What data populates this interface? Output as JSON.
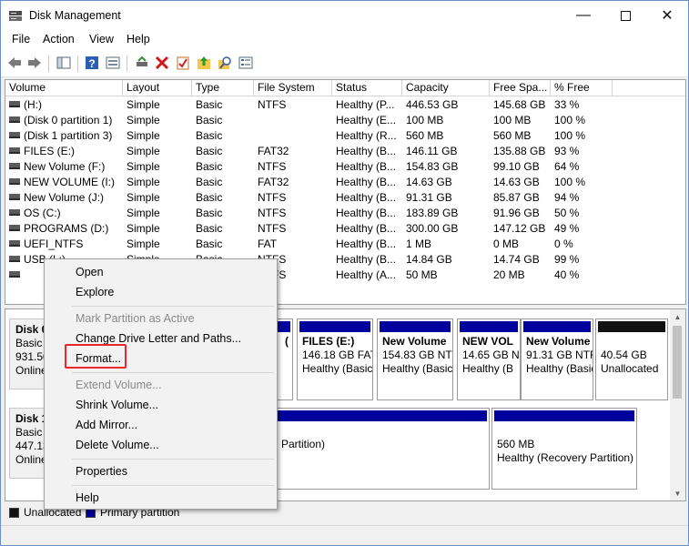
{
  "window": {
    "title": "Disk Management"
  },
  "menubar": {
    "items": [
      "File",
      "Action",
      "View",
      "Help"
    ]
  },
  "table": {
    "columns": [
      "Volume",
      "Layout",
      "Type",
      "File System",
      "Status",
      "Capacity",
      "Free Spa...",
      "% Free"
    ],
    "rows": [
      [
        "(H:)",
        "Simple",
        "Basic",
        "NTFS",
        "Healthy (P...",
        "446.53 GB",
        "145.68 GB",
        "33 %"
      ],
      [
        "(Disk 0 partition 1)",
        "Simple",
        "Basic",
        "",
        "Healthy (E...",
        "100 MB",
        "100 MB",
        "100 %"
      ],
      [
        "(Disk 1 partition 3)",
        "Simple",
        "Basic",
        "",
        "Healthy (R...",
        "560 MB",
        "560 MB",
        "100 %"
      ],
      [
        "FILES (E:)",
        "Simple",
        "Basic",
        "FAT32",
        "Healthy (B...",
        "146.11 GB",
        "135.88 GB",
        "93 %"
      ],
      [
        "New Volume (F:)",
        "Simple",
        "Basic",
        "NTFS",
        "Healthy (B...",
        "154.83 GB",
        "99.10 GB",
        "64 %"
      ],
      [
        "NEW VOLUME (I:)",
        "Simple",
        "Basic",
        "FAT32",
        "Healthy (B...",
        "14.63 GB",
        "14.63 GB",
        "100 %"
      ],
      [
        "New Volume (J:)",
        "Simple",
        "Basic",
        "NTFS",
        "Healthy (B...",
        "91.31 GB",
        "85.87 GB",
        "94 %"
      ],
      [
        "OS (C:)",
        "Simple",
        "Basic",
        "NTFS",
        "Healthy (B...",
        "183.89 GB",
        "91.96 GB",
        "50 %"
      ],
      [
        "PROGRAMS (D:)",
        "Simple",
        "Basic",
        "NTFS",
        "Healthy (B...",
        "300.00 GB",
        "147.12 GB",
        "49 %"
      ],
      [
        "UEFI_NTFS",
        "Simple",
        "Basic",
        "FAT",
        "Healthy (B...",
        "1 MB",
        "0 MB",
        "0 %"
      ],
      [
        "USB (L:)",
        "Simple",
        "Basic",
        "NTFS",
        "Healthy (B...",
        "14.84 GB",
        "14.74 GB",
        "99 %"
      ],
      [
        "",
        "Simple",
        "Basic",
        "NTFS",
        "Healthy (A...",
        "50 MB",
        "20 MB",
        "40 %"
      ]
    ]
  },
  "disks": [
    {
      "title": "Disk 0",
      "type": "Basic",
      "size": "931.50",
      "state": "Online"
    },
    {
      "title": "Disk 1",
      "type": "Basic",
      "size": "447.13",
      "state": "Online"
    }
  ],
  "partitions": {
    "disk0": [
      {
        "name": "(",
        "line2": "",
        "line3": ""
      },
      {
        "name": "FILES  (E:)",
        "line2": "146.18 GB FAT",
        "line3": "Healthy (Basic"
      },
      {
        "name": "New Volume",
        "line2": "154.83 GB NTFS",
        "line3": "Healthy (Basic"
      },
      {
        "name": "NEW VOL",
        "line2": "14.65 GB NTF",
        "line3": "Healthy (B"
      },
      {
        "name": "New Volume",
        "line2": "91.31 GB NTFS",
        "line3": "Healthy (Basic"
      },
      {
        "name": "",
        "line2": "40.54 GB",
        "line3": "Unallocated"
      }
    ],
    "disk1": [
      {
        "name": "",
        "line2": "",
        "line3": "Partition)"
      },
      {
        "name": "",
        "line2": "560 MB",
        "line3": "Healthy (Recovery Partition)"
      }
    ]
  },
  "legend": {
    "unallocated": "Unallocated",
    "primary": "Primary partition"
  },
  "context_menu": {
    "items": [
      {
        "label": "Open",
        "enabled": true
      },
      {
        "label": "Explore",
        "enabled": true
      },
      {
        "label": "Mark Partition as Active",
        "enabled": false
      },
      {
        "label": "Change Drive Letter and Paths...",
        "enabled": true
      },
      {
        "label": "Format...",
        "enabled": true
      },
      {
        "label": "Extend Volume...",
        "enabled": false
      },
      {
        "label": "Shrink Volume...",
        "enabled": true
      },
      {
        "label": "Add Mirror...",
        "enabled": true
      },
      {
        "label": "Delete Volume...",
        "enabled": true
      },
      {
        "label": "Properties",
        "enabled": true
      },
      {
        "label": "Help",
        "enabled": true
      }
    ]
  },
  "colors": {
    "primary_partition": "#00009c",
    "unallocated": "#111111",
    "highlight": "#e8262c"
  }
}
